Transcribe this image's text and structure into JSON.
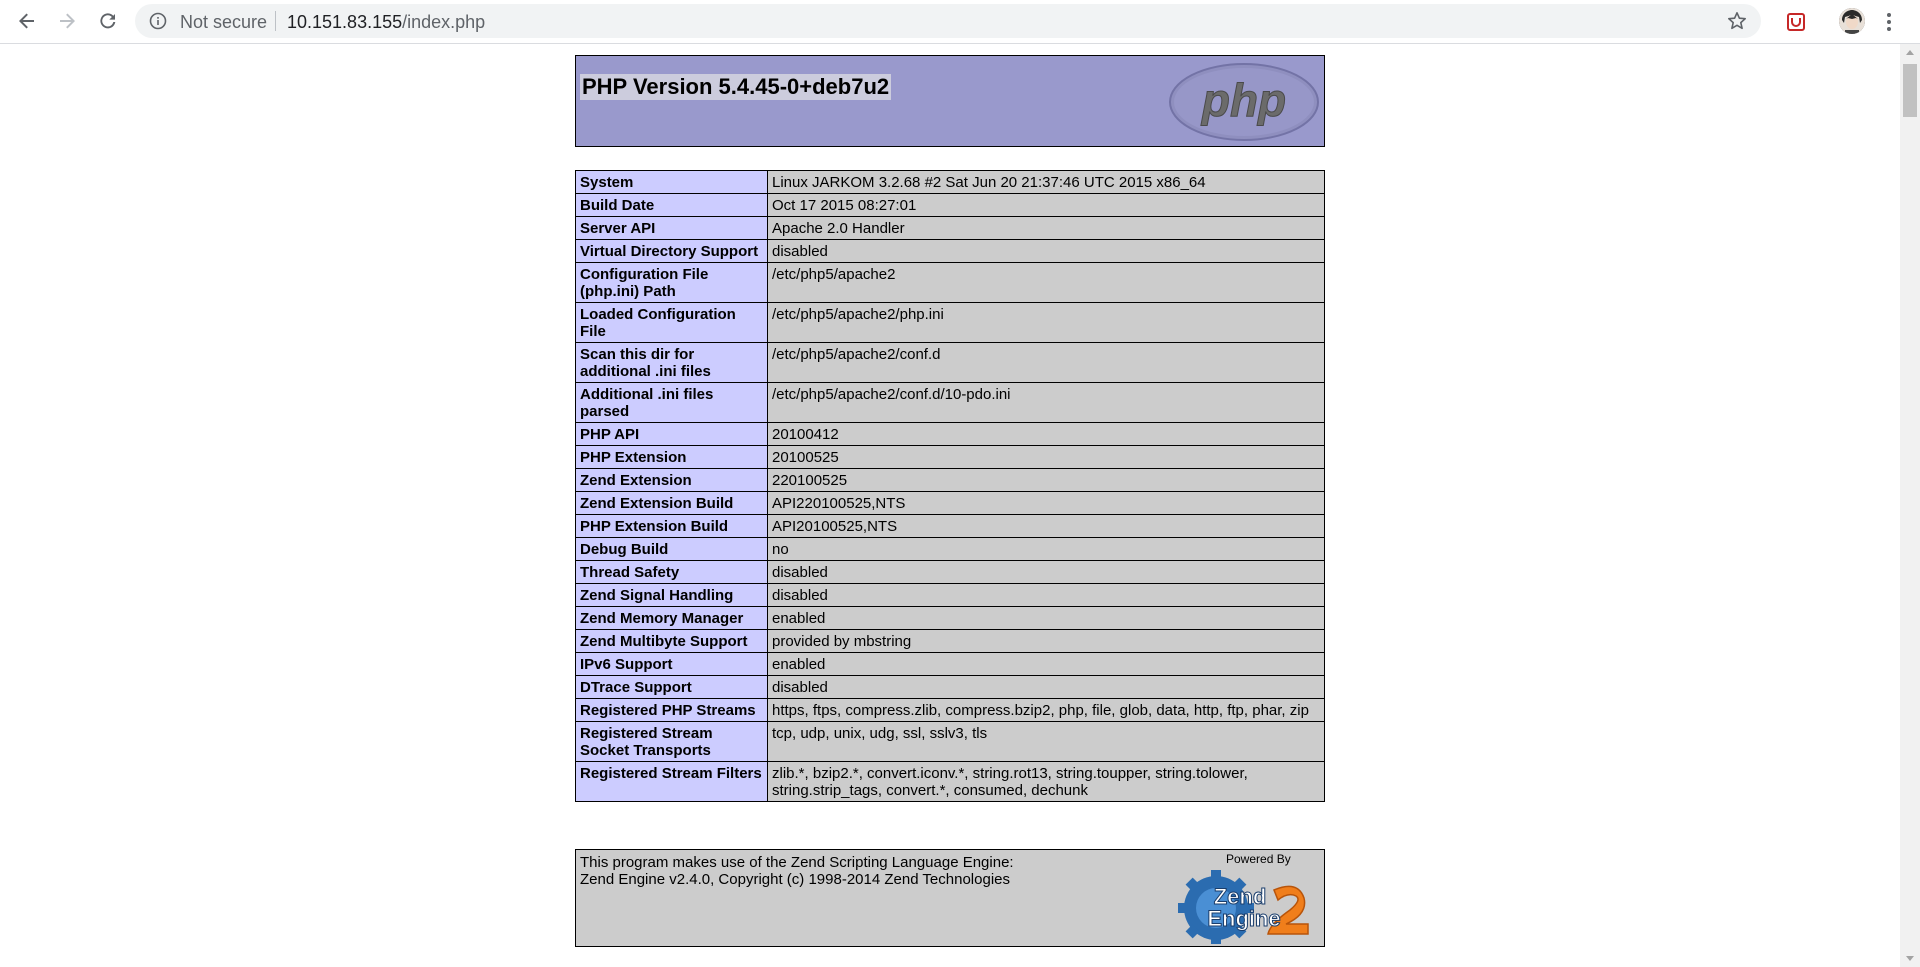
{
  "browser": {
    "secure_label": "Not secure",
    "url_host": "10.151.83.155",
    "url_path": "/index.php"
  },
  "header": {
    "title": "PHP Version 5.4.45-0+deb7u2",
    "logo_text": "php"
  },
  "info_table": [
    {
      "key": "System",
      "value": "Linux JARKOM 3.2.68 #2 Sat Jun 20 21:37:46 UTC 2015 x86_64"
    },
    {
      "key": "Build Date",
      "value": "Oct 17 2015 08:27:01"
    },
    {
      "key": "Server API",
      "value": "Apache 2.0 Handler"
    },
    {
      "key": "Virtual Directory Support",
      "value": "disabled"
    },
    {
      "key": "Configuration File (php.ini) Path",
      "value": "/etc/php5/apache2"
    },
    {
      "key": "Loaded Configuration File",
      "value": "/etc/php5/apache2/php.ini"
    },
    {
      "key": "Scan this dir for additional .ini files",
      "value": "/etc/php5/apache2/conf.d"
    },
    {
      "key": "Additional .ini files parsed",
      "value": "/etc/php5/apache2/conf.d/10-pdo.ini"
    },
    {
      "key": "PHP API",
      "value": "20100412"
    },
    {
      "key": "PHP Extension",
      "value": "20100525"
    },
    {
      "key": "Zend Extension",
      "value": "220100525"
    },
    {
      "key": "Zend Extension Build",
      "value": "API220100525,NTS"
    },
    {
      "key": "PHP Extension Build",
      "value": "API20100525,NTS"
    },
    {
      "key": "Debug Build",
      "value": "no"
    },
    {
      "key": "Thread Safety",
      "value": "disabled"
    },
    {
      "key": "Zend Signal Handling",
      "value": "disabled"
    },
    {
      "key": "Zend Memory Manager",
      "value": "enabled"
    },
    {
      "key": "Zend Multibyte Support",
      "value": "provided by mbstring"
    },
    {
      "key": "IPv6 Support",
      "value": "enabled"
    },
    {
      "key": "DTrace Support",
      "value": "disabled"
    },
    {
      "key": "Registered PHP Streams",
      "value": "https, ftps, compress.zlib, compress.bzip2, php, file, glob, data, http, ftp, phar, zip"
    },
    {
      "key": "Registered Stream Socket Transports",
      "value": "tcp, udp, unix, udg, ssl, sslv3, tls"
    },
    {
      "key": "Registered Stream Filters",
      "value": "zlib.*, bzip2.*, convert.iconv.*, string.rot13, string.toupper, string.tolower, string.strip_tags, convert.*, consumed, dechunk"
    }
  ],
  "footer": {
    "line1": "This program makes use of the Zend Scripting Language Engine:",
    "line2": "Zend Engine v2.4.0, Copyright (c) 1998-2014 Zend Technologies",
    "powered_by": "Powered By",
    "logo_text": "Zend Engine 2"
  },
  "icons": {
    "back": "back-arrow-icon",
    "forward": "forward-arrow-icon",
    "reload": "reload-icon",
    "info": "info-icon",
    "star": "star-icon",
    "extension": "extension-icon",
    "avatar": "profile-avatar",
    "menu": "kebab-menu-icon"
  },
  "colors": {
    "header_bg": "#9999cc",
    "label_cell_bg": "#ccccff",
    "value_cell_bg": "#cccccc"
  }
}
